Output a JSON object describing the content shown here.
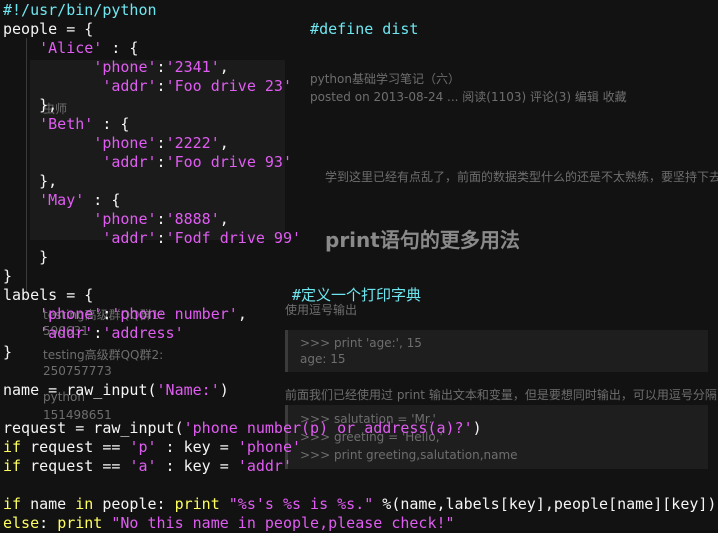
{
  "background": {
    "blog_title": "python基础学习笔记（六）",
    "blog_meta": "posted on 2013-08-24 ... 阅读(1103) 评论(3) 编辑 收藏",
    "section_heading": "print语句的更多用法",
    "sub_heading": "使用逗号输出",
    "side_label_1": "testing高级群QQ群1:",
    "side_label_2": "testing高级群QQ群2:",
    "side_num_1": "590631",
    "side_num_2": "250757773",
    "side_num_3": "151498651",
    "side_num_4": "python",
    "side_heading": "虫师",
    "code_line_1": ">>> print 'age:', 15",
    "code_line_2": "age: 15",
    "code_line_3": ">>> salutation = 'Mr.'",
    "code_line_4": ">>> greeting = 'Hello,'",
    "code_line_5": ">>> print greeting,salutation,name",
    "desc_text": "学到这里已经有点乱了，前面的数据类型什么的还是不太熟练，要坚持下去",
    "desc_text_2": "前面我们已经使用过 print 输出文本和变量，但是要想同时输出，可以用逗号分隔"
  },
  "editor": {
    "lines": [
      [
        {
          "t": "#!/usr/bin/python",
          "c": "c"
        }
      ],
      [
        {
          "t": "people = {",
          "c": "w"
        },
        {
          "t": "                        #define dist",
          "c": "c"
        }
      ],
      [
        {
          "t": "    ",
          "c": "w"
        },
        {
          "t": "'Alice'",
          "c": "s"
        },
        {
          "t": " : {",
          "c": "w"
        }
      ],
      [
        {
          "t": "          ",
          "c": "w"
        },
        {
          "t": "'phone'",
          "c": "s"
        },
        {
          "t": ":",
          "c": "w"
        },
        {
          "t": "'2341'",
          "c": "s"
        },
        {
          "t": ",",
          "c": "w"
        }
      ],
      [
        {
          "t": "           ",
          "c": "w"
        },
        {
          "t": "'addr'",
          "c": "s"
        },
        {
          "t": ":",
          "c": "w"
        },
        {
          "t": "'Foo drive 23'",
          "c": "s"
        }
      ],
      [
        {
          "t": "    },",
          "c": "w"
        }
      ],
      [
        {
          "t": "    ",
          "c": "w"
        },
        {
          "t": "'Beth'",
          "c": "s"
        },
        {
          "t": " : {",
          "c": "w"
        }
      ],
      [
        {
          "t": "          ",
          "c": "w"
        },
        {
          "t": "'phone'",
          "c": "s"
        },
        {
          "t": ":",
          "c": "w"
        },
        {
          "t": "'2222'",
          "c": "s"
        },
        {
          "t": ",",
          "c": "w"
        }
      ],
      [
        {
          "t": "           ",
          "c": "w"
        },
        {
          "t": "'addr'",
          "c": "s"
        },
        {
          "t": ":",
          "c": "w"
        },
        {
          "t": "'Foo drive 93'",
          "c": "s"
        }
      ],
      [
        {
          "t": "    },",
          "c": "w"
        }
      ],
      [
        {
          "t": "    ",
          "c": "w"
        },
        {
          "t": "'May'",
          "c": "s"
        },
        {
          "t": " : {",
          "c": "w"
        }
      ],
      [
        {
          "t": "          ",
          "c": "w"
        },
        {
          "t": "'phone'",
          "c": "s"
        },
        {
          "t": ":",
          "c": "w"
        },
        {
          "t": "'8888'",
          "c": "s"
        },
        {
          "t": ",",
          "c": "w"
        }
      ],
      [
        {
          "t": "           ",
          "c": "w"
        },
        {
          "t": "'addr'",
          "c": "s"
        },
        {
          "t": ":",
          "c": "w"
        },
        {
          "t": "'Fodf drive 99'",
          "c": "s"
        }
      ],
      [
        {
          "t": "    }",
          "c": "w"
        }
      ],
      [
        {
          "t": "}",
          "c": "w"
        }
      ],
      [
        {
          "t": "labels = {",
          "c": "w"
        },
        {
          "t": "                      #定义一个打印字典",
          "c": "c"
        }
      ],
      [
        {
          "t": "    ",
          "c": "w"
        },
        {
          "t": "'phone'",
          "c": "s"
        },
        {
          "t": ":",
          "c": "w"
        },
        {
          "t": "'phone number'",
          "c": "s"
        },
        {
          "t": ",",
          "c": "w"
        }
      ],
      [
        {
          "t": "    ",
          "c": "w"
        },
        {
          "t": "'addr'",
          "c": "s"
        },
        {
          "t": ":",
          "c": "w"
        },
        {
          "t": "'address'",
          "c": "s"
        }
      ],
      [
        {
          "t": "}",
          "c": "w"
        }
      ],
      [
        {
          "t": "",
          "c": "w"
        }
      ],
      [
        {
          "t": "name = raw_input(",
          "c": "w"
        },
        {
          "t": "'Name:'",
          "c": "s"
        },
        {
          "t": ")",
          "c": "w"
        }
      ],
      [
        {
          "t": "",
          "c": "w"
        }
      ],
      [
        {
          "t": "request = raw_input(",
          "c": "w"
        },
        {
          "t": "'phone number(p) or address(a)?'",
          "c": "s"
        },
        {
          "t": ")",
          "c": "w"
        }
      ],
      [
        {
          "t": "if",
          "c": "k"
        },
        {
          "t": " request == ",
          "c": "w"
        },
        {
          "t": "'p'",
          "c": "s"
        },
        {
          "t": " : key = ",
          "c": "w"
        },
        {
          "t": "'phone'",
          "c": "s"
        }
      ],
      [
        {
          "t": "if",
          "c": "k"
        },
        {
          "t": " request == ",
          "c": "w"
        },
        {
          "t": "'a'",
          "c": "s"
        },
        {
          "t": " : key = ",
          "c": "w"
        },
        {
          "t": "'addr'",
          "c": "s"
        }
      ],
      [
        {
          "t": "",
          "c": "w"
        }
      ],
      [
        {
          "t": "if",
          "c": "k"
        },
        {
          "t": " name ",
          "c": "w"
        },
        {
          "t": "in",
          "c": "k"
        },
        {
          "t": " people: ",
          "c": "w"
        },
        {
          "t": "print",
          "c": "k"
        },
        {
          "t": " ",
          "c": "w"
        },
        {
          "t": "\"%s's %s is %s.\"",
          "c": "s"
        },
        {
          "t": " %(name,labels[key],people[name][key])",
          "c": "w"
        }
      ],
      [
        {
          "t": "else",
          "c": "k"
        },
        {
          "t": ": ",
          "c": "w"
        },
        {
          "t": "print",
          "c": "k"
        },
        {
          "t": " ",
          "c": "w"
        },
        {
          "t": "\"No this name in people,please check!\"",
          "c": "s"
        }
      ]
    ]
  },
  "colors": {
    "editor_bg": "#0f0f0f",
    "text": "#f5f5f5",
    "string": "#e05cf2",
    "keyword": "#ffff60",
    "comment": "#6ee6f0"
  }
}
